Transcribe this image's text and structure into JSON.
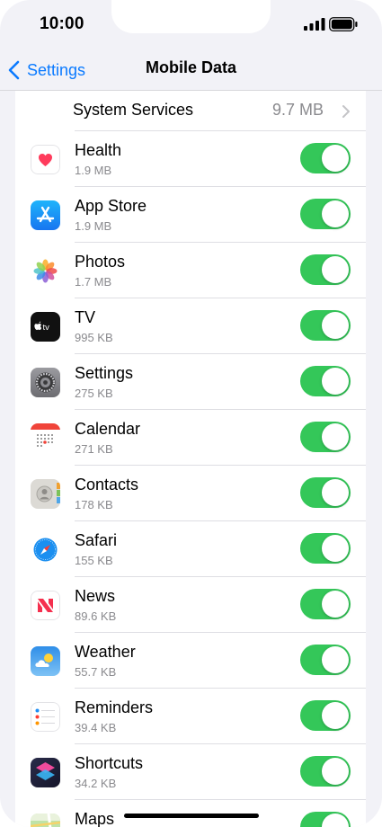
{
  "status_bar": {
    "time": "10:00",
    "icons": [
      "signal-icon",
      "battery-icon"
    ]
  },
  "nav": {
    "back_label": "Settings",
    "title": "Mobile Data"
  },
  "system_services": {
    "label": "System Services",
    "value": "9.7 MB"
  },
  "apps": [
    {
      "name": "Health",
      "size": "1.9 MB",
      "icon": "health-icon",
      "enabled": true
    },
    {
      "name": "App Store",
      "size": "1.9 MB",
      "icon": "app-store-icon",
      "enabled": true
    },
    {
      "name": "Photos",
      "size": "1.7 MB",
      "icon": "photos-icon",
      "enabled": true
    },
    {
      "name": "TV",
      "size": "995 KB",
      "icon": "tv-icon",
      "enabled": true
    },
    {
      "name": "Settings",
      "size": "275 KB",
      "icon": "settings-icon",
      "enabled": true
    },
    {
      "name": "Calendar",
      "size": "271 KB",
      "icon": "calendar-icon",
      "enabled": true
    },
    {
      "name": "Contacts",
      "size": "178 KB",
      "icon": "contacts-icon",
      "enabled": true
    },
    {
      "name": "Safari",
      "size": "155 KB",
      "icon": "safari-icon",
      "enabled": true
    },
    {
      "name": "News",
      "size": "89.6 KB",
      "icon": "news-icon",
      "enabled": true
    },
    {
      "name": "Weather",
      "size": "55.7 KB",
      "icon": "weather-icon",
      "enabled": true
    },
    {
      "name": "Reminders",
      "size": "39.4 KB",
      "icon": "reminders-icon",
      "enabled": true
    },
    {
      "name": "Shortcuts",
      "size": "34.2 KB",
      "icon": "shortcuts-icon",
      "enabled": true
    },
    {
      "name": "Maps",
      "size": "",
      "icon": "maps-icon",
      "enabled": true
    }
  ],
  "colors": {
    "accent": "#0a7aff",
    "toggle_on": "#34c759",
    "background": "#f2f2f7",
    "secondary_text": "#8a8a8e"
  }
}
